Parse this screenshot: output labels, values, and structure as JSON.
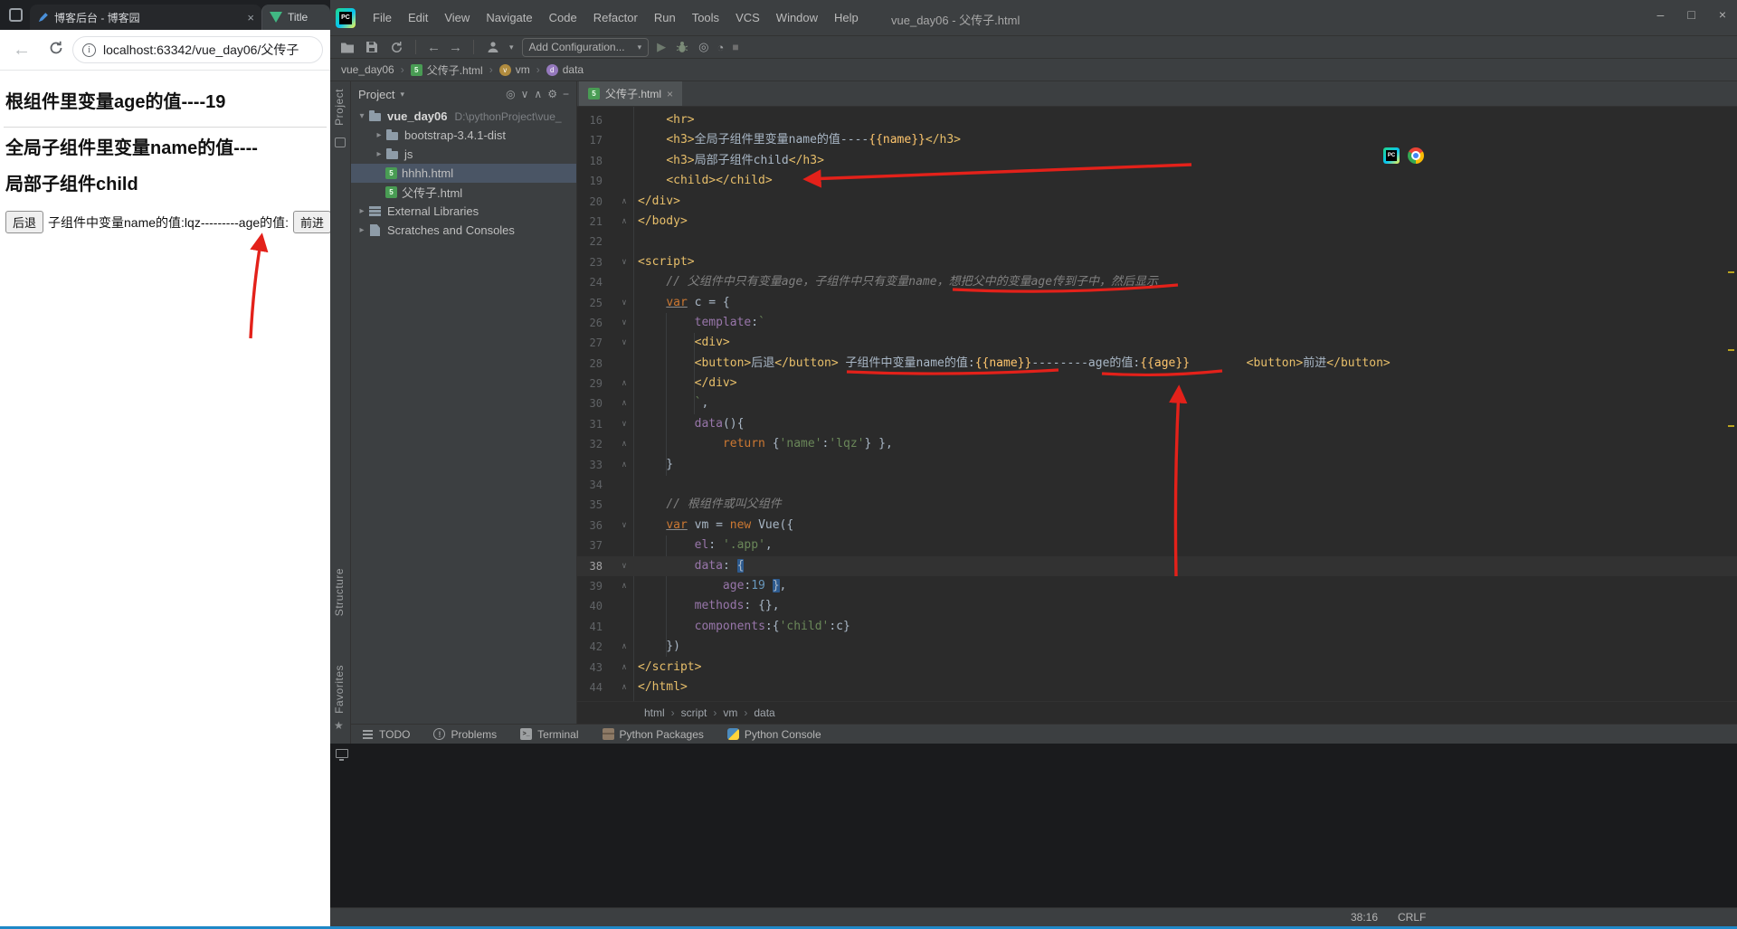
{
  "colors": {
    "annotation_red": "#e3211a",
    "editor_bg": "#2b2b2b",
    "ide_chrome": "#3c3f41",
    "tag_yellow": "#e8bf6a",
    "string_green": "#6a8759",
    "keyword_orange": "#cc7832",
    "selection_blue": "#2d5a8e",
    "tree_selection": "#4a5565",
    "html_icon_green": "#499c54"
  },
  "browser": {
    "tabs": [
      {
        "title": "博客后台 - 博客园"
      },
      {
        "title": "Title"
      }
    ],
    "address": "localhost:63342/vue_day06/父传子",
    "page": {
      "heading1": "根组件里变量age的值----19",
      "heading2": "全局子组件里变量name的值----",
      "heading3": "局部子组件child",
      "back_button": "后退",
      "child_text": "子组件中变量name的值:lqz---------age的值:",
      "forward_button": "前进"
    }
  },
  "ide": {
    "menu": [
      "File",
      "Edit",
      "View",
      "Navigate",
      "Code",
      "Refactor",
      "Run",
      "Tools",
      "VCS",
      "Window",
      "Help"
    ],
    "window_title": "vue_day06 - 父传子.html",
    "window_controls": [
      "–",
      "□",
      "×"
    ],
    "toolbar": {
      "run_config": "Add Configuration..."
    },
    "breadcrumbs_top": [
      {
        "label": "vue_day06",
        "icon": null
      },
      {
        "label": "父传子.html",
        "icon": "html"
      },
      {
        "label": "vm",
        "icon": "v"
      },
      {
        "label": "data",
        "icon": "d"
      }
    ],
    "stripe": [
      "Project",
      "Structure",
      "Favorites"
    ],
    "project_panel": {
      "title": "Project",
      "tree": [
        {
          "label": "vue_day06",
          "path": "D:\\pythonProject\\vue_",
          "icon": "folder",
          "arrow": "down",
          "level": 0,
          "root": true
        },
        {
          "label": "bootstrap-3.4.1-dist",
          "icon": "folder",
          "arrow": "right",
          "level": 1
        },
        {
          "label": "js",
          "icon": "folder",
          "arrow": "right",
          "level": 1
        },
        {
          "label": "hhhh.html",
          "icon": "html",
          "arrow": null,
          "level": 1,
          "selected": true
        },
        {
          "label": "父传子.html",
          "icon": "html",
          "arrow": null,
          "level": 1
        },
        {
          "label": "External Libraries",
          "icon": "lib",
          "arrow": "right",
          "level": 0
        },
        {
          "label": "Scratches and Consoles",
          "icon": "scratch",
          "arrow": "right",
          "level": 0
        }
      ]
    },
    "editor": {
      "tab": "父传子.html",
      "current_line": 38,
      "lines": [
        {
          "n": 16,
          "segs": [
            [
              "txt",
              "    "
            ],
            [
              "tag",
              "<hr>"
            ]
          ]
        },
        {
          "n": 17,
          "segs": [
            [
              "txt",
              "    "
            ],
            [
              "tag",
              "<h3>"
            ],
            [
              "txt",
              "全局子组件里变量name的值----"
            ],
            [
              "mus",
              "{{name}}"
            ],
            [
              "tag",
              "</h3>"
            ]
          ]
        },
        {
          "n": 18,
          "segs": [
            [
              "txt",
              "    "
            ],
            [
              "tag",
              "<h3>"
            ],
            [
              "txt",
              "局部子组件child"
            ],
            [
              "tag",
              "</h3>"
            ]
          ]
        },
        {
          "n": 19,
          "segs": [
            [
              "txt",
              "    "
            ],
            [
              "tag",
              "<child></child>"
            ]
          ]
        },
        {
          "n": 20,
          "f": "e",
          "segs": [
            [
              "tag",
              "</div>"
            ]
          ]
        },
        {
          "n": 21,
          "f": "e",
          "segs": [
            [
              "tag",
              "</body>"
            ]
          ]
        },
        {
          "n": 22,
          "segs": []
        },
        {
          "n": 23,
          "f": "s",
          "segs": [
            [
              "tag",
              "<script>"
            ]
          ]
        },
        {
          "n": 24,
          "segs": [
            [
              "txt",
              "    "
            ],
            [
              "com",
              "// 父组件中只有变量age，子组件中只有变量name，想把父中的变量age传到子中，然后显示"
            ]
          ]
        },
        {
          "n": 25,
          "f": "s",
          "segs": [
            [
              "txt",
              "    "
            ],
            [
              "kwu",
              "var"
            ],
            [
              "txt",
              " c = {"
            ]
          ]
        },
        {
          "n": 26,
          "f": "s",
          "segs": [
            [
              "txt",
              "        "
            ],
            [
              "key",
              "template"
            ],
            [
              "txt",
              ":"
            ],
            [
              "str",
              "`"
            ]
          ]
        },
        {
          "n": 27,
          "f": "s",
          "segs": [
            [
              "txt",
              "        "
            ],
            [
              "tag",
              "<div>"
            ]
          ]
        },
        {
          "n": 28,
          "segs": [
            [
              "txt",
              "        "
            ],
            [
              "tag",
              "<button>"
            ],
            [
              "txt",
              "后退"
            ],
            [
              "tag",
              "</button>"
            ],
            [
              "txt",
              " 子组件中变量name的值:"
            ],
            [
              "mus",
              "{{name}}"
            ],
            [
              "txt",
              "--------age的值:"
            ],
            [
              "mus",
              "{{age}}"
            ],
            [
              "txt",
              "        "
            ],
            [
              "tag",
              "<button>"
            ],
            [
              "txt",
              "前进"
            ],
            [
              "tag",
              "</button>"
            ]
          ]
        },
        {
          "n": 29,
          "f": "e",
          "segs": [
            [
              "txt",
              "        "
            ],
            [
              "tag",
              "</div>"
            ]
          ]
        },
        {
          "n": 30,
          "f": "e",
          "segs": [
            [
              "txt",
              "        "
            ],
            [
              "str",
              "`"
            ],
            [
              "txt",
              ","
            ]
          ]
        },
        {
          "n": 31,
          "f": "s",
          "segs": [
            [
              "txt",
              "        "
            ],
            [
              "key",
              "data"
            ],
            [
              "txt",
              "(){"
            ]
          ]
        },
        {
          "n": 32,
          "f": "e",
          "segs": [
            [
              "txt",
              "            "
            ],
            [
              "kw",
              "return"
            ],
            [
              "txt",
              " {"
            ],
            [
              "str",
              "'name'"
            ],
            [
              "txt",
              ":"
            ],
            [
              "str",
              "'lqz'"
            ],
            [
              "txt",
              "} },"
            ]
          ]
        },
        {
          "n": 33,
          "f": "e",
          "segs": [
            [
              "txt",
              "    }"
            ]
          ]
        },
        {
          "n": 34,
          "segs": []
        },
        {
          "n": 35,
          "segs": [
            [
              "txt",
              "    "
            ],
            [
              "com",
              "// 根组件或叫父组件"
            ]
          ]
        },
        {
          "n": 36,
          "f": "s",
          "segs": [
            [
              "txt",
              "    "
            ],
            [
              "kwu",
              "var"
            ],
            [
              "txt",
              " vm = "
            ],
            [
              "kw",
              "new"
            ],
            [
              "txt",
              " Vue({"
            ]
          ]
        },
        {
          "n": 37,
          "segs": [
            [
              "txt",
              "        "
            ],
            [
              "key",
              "el"
            ],
            [
              "txt",
              ": "
            ],
            [
              "str",
              "'.app'"
            ],
            [
              "txt",
              ","
            ]
          ]
        },
        {
          "n": 38,
          "f": "s",
          "cur": true,
          "segs": [
            [
              "txt",
              "        "
            ],
            [
              "key",
              "data"
            ],
            [
              "txt",
              ": "
            ],
            [
              "brc",
              "{"
            ]
          ]
        },
        {
          "n": 39,
          "f": "e",
          "segs": [
            [
              "txt",
              "            "
            ],
            [
              "key",
              "age"
            ],
            [
              "txt",
              ":"
            ],
            [
              "num",
              "19"
            ],
            [
              "txt",
              " "
            ],
            [
              "brc",
              "}"
            ],
            [
              "txt",
              ","
            ]
          ]
        },
        {
          "n": 40,
          "segs": [
            [
              "txt",
              "        "
            ],
            [
              "key",
              "methods"
            ],
            [
              "txt",
              ": {},"
            ]
          ]
        },
        {
          "n": 41,
          "segs": [
            [
              "txt",
              "        "
            ],
            [
              "key",
              "components"
            ],
            [
              "txt",
              ":{"
            ],
            [
              "str",
              "'child'"
            ],
            [
              "txt",
              ":c}"
            ]
          ]
        },
        {
          "n": 42,
          "f": "e",
          "segs": [
            [
              "txt",
              "    })"
            ]
          ]
        },
        {
          "n": 43,
          "f": "e",
          "segs": [
            [
              "tag",
              "</script>"
            ]
          ]
        },
        {
          "n": 44,
          "f": "e",
          "segs": [
            [
              "tag",
              "</html>"
            ]
          ]
        }
      ]
    },
    "breadcrumbs_bottom": [
      "html",
      "script",
      "vm",
      "data"
    ],
    "tool_windows": [
      {
        "label": "TODO",
        "icon": "todo"
      },
      {
        "label": "Problems",
        "icon": "problems"
      },
      {
        "label": "Terminal",
        "icon": "terminal"
      },
      {
        "label": "Python Packages",
        "icon": "package"
      },
      {
        "label": "Python Console",
        "icon": "python"
      }
    ],
    "status": {
      "position": "38:16",
      "line_ending": "CRLF"
    }
  },
  "annotations": [
    "arrow-to-child-tag",
    "arrow-to-age-interpolation",
    "arrow-to-forward-button",
    "underline-comment",
    "underline-name-binding",
    "underline-age-binding"
  ]
}
